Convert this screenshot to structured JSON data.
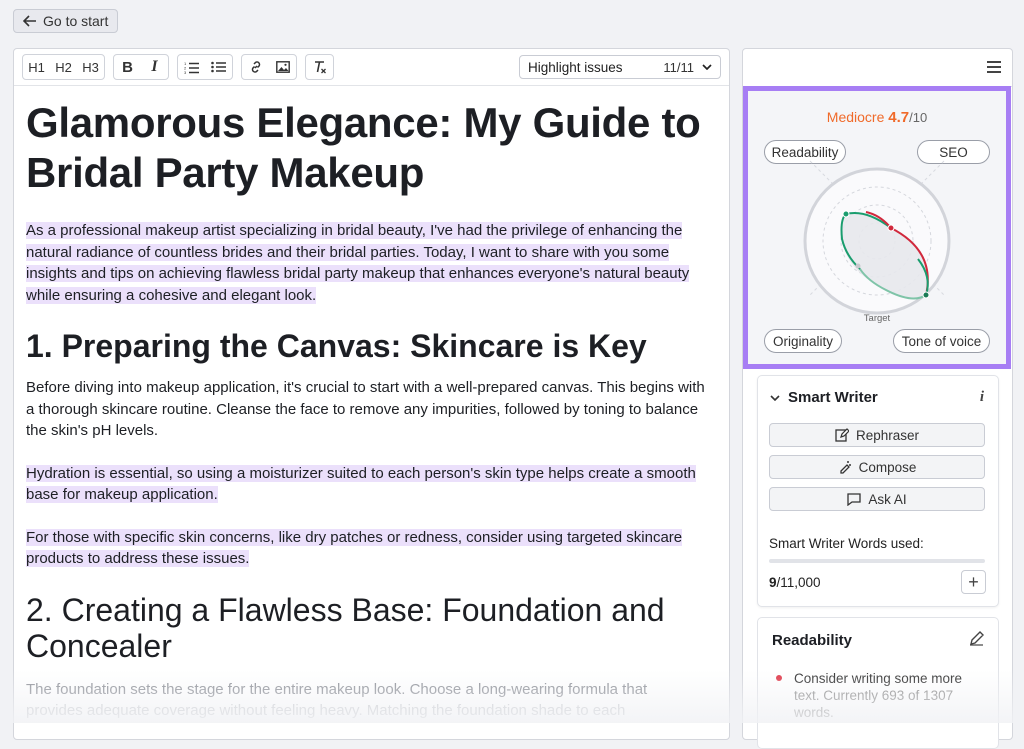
{
  "top": {
    "back_label": "Go to start"
  },
  "toolbar": {
    "h1": "H1",
    "h2": "H2",
    "h3": "H3",
    "bold": "B",
    "italic": "I",
    "highlight_label": "Highlight issues",
    "highlight_count": "11/11"
  },
  "doc": {
    "title": "Glamorous Elegance: My Guide to Bridal Party Makeup",
    "intro_lines": [
      "As a professional makeup artist specializing in bridal beauty, I've had the privilege of enhancing the",
      "natural radiance of countless brides and their bridal parties. Today, I want to share with you some",
      "insights and tips on achieving flawless bridal party makeup that enhances everyone's natural beauty",
      "while ensuring a cohesive and elegant look."
    ],
    "h2_1": "1. Preparing the Canvas: Skincare is Key",
    "p1": "Before diving into makeup application, it's crucial to start with a well-prepared canvas. This begins with a thorough skincare routine. Cleanse the face to remove any impurities, followed by toning to balance the skin's pH levels.",
    "p2_lines": [
      "Hydration is essential, so using a moisturizer suited to each person's skin type helps create a smooth",
      "base for makeup application."
    ],
    "p3_lines": [
      "For those with specific skin concerns, like dry patches or redness, consider using targeted skincare",
      "products to address these issues."
    ],
    "h2_2": "2. Creating a Flawless Base: Foundation and Concealer",
    "p4_line1": "The foundation sets the stage for the entire makeup look. Choose a long-wearing formula that",
    "p4_line2": "provides adequate coverage without feeling heavy. Matching the foundation shade to each"
  },
  "score": {
    "label": "Mediocre",
    "value": "4.7",
    "max": "/10",
    "target_label": "Target",
    "pills": {
      "readability": "Readability",
      "seo": "SEO",
      "originality": "Originality",
      "tone": "Tone of voice"
    },
    "label_color": "#f06a2a"
  },
  "smart_writer": {
    "title": "Smart Writer",
    "info": "i",
    "rephraser": "Rephraser",
    "compose": "Compose",
    "ask_ai": "Ask AI",
    "words_label": "Smart Writer Words used:",
    "words_used": "9",
    "words_total": "/11,000",
    "plus": "+"
  },
  "readability_card": {
    "title": "Readability",
    "item_line1": "Consider writing some more",
    "item_line2": "text. Currently 693 of 1307",
    "item_line3": "words."
  },
  "colors": {
    "highlight": "#ebe0fb",
    "frame": "#a77ef4",
    "green": "#1a9d6e",
    "red": "#d1283c"
  }
}
